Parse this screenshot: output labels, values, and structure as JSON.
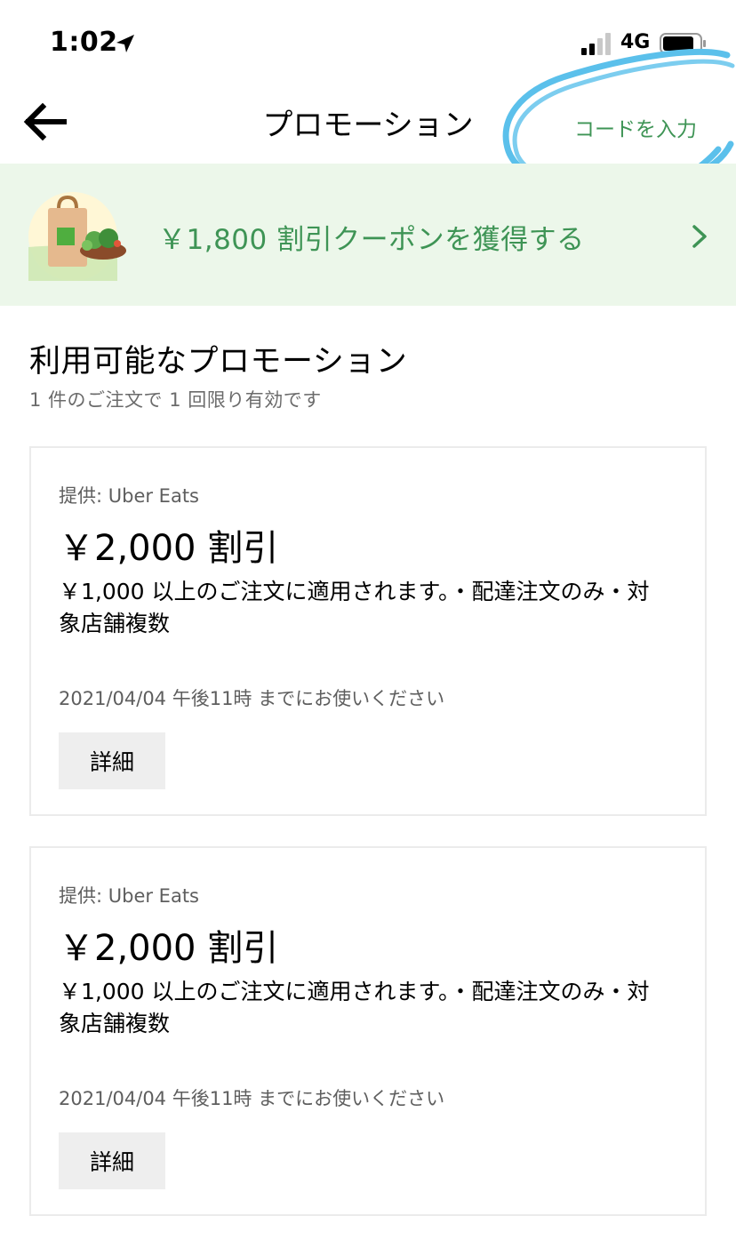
{
  "status_bar": {
    "time": "1:02",
    "network": "4G"
  },
  "header": {
    "title": "プロモーション",
    "enter_code_label": "コードを入力"
  },
  "banner": {
    "text": "￥1,800 割引クーポンを獲得する"
  },
  "section": {
    "title": "利用可能なプロモーション",
    "subtitle": "1 件のご注文で 1 回限り有効です"
  },
  "promotions": [
    {
      "provider": "提供: Uber Eats",
      "amount": "￥2,000 割引",
      "description": "￥1,000 以上のご注文に適用されます。・配達注文のみ・対象店舗複数",
      "expiry": "2021/04/04 午後11時 までにお使いください",
      "details_label": "詳細"
    },
    {
      "provider": "提供: Uber Eats",
      "amount": "￥2,000 割引",
      "description": "￥1,000 以上のご注文に適用されます。・配達注文のみ・対象店舗複数",
      "expiry": "2021/04/04 午後11時 までにお使いください",
      "details_label": "詳細"
    }
  ],
  "icons": {
    "back": "arrow-left-icon",
    "chevron": "chevron-right-icon",
    "location": "location-arrow-icon",
    "signal": "signal-bars-icon",
    "battery": "battery-icon",
    "banner": "grocery-bag-salad-icon"
  },
  "colors": {
    "accent_green": "#3e9455",
    "banner_bg": "#ecf7ea",
    "annotation_blue": "#5bc0eb"
  }
}
